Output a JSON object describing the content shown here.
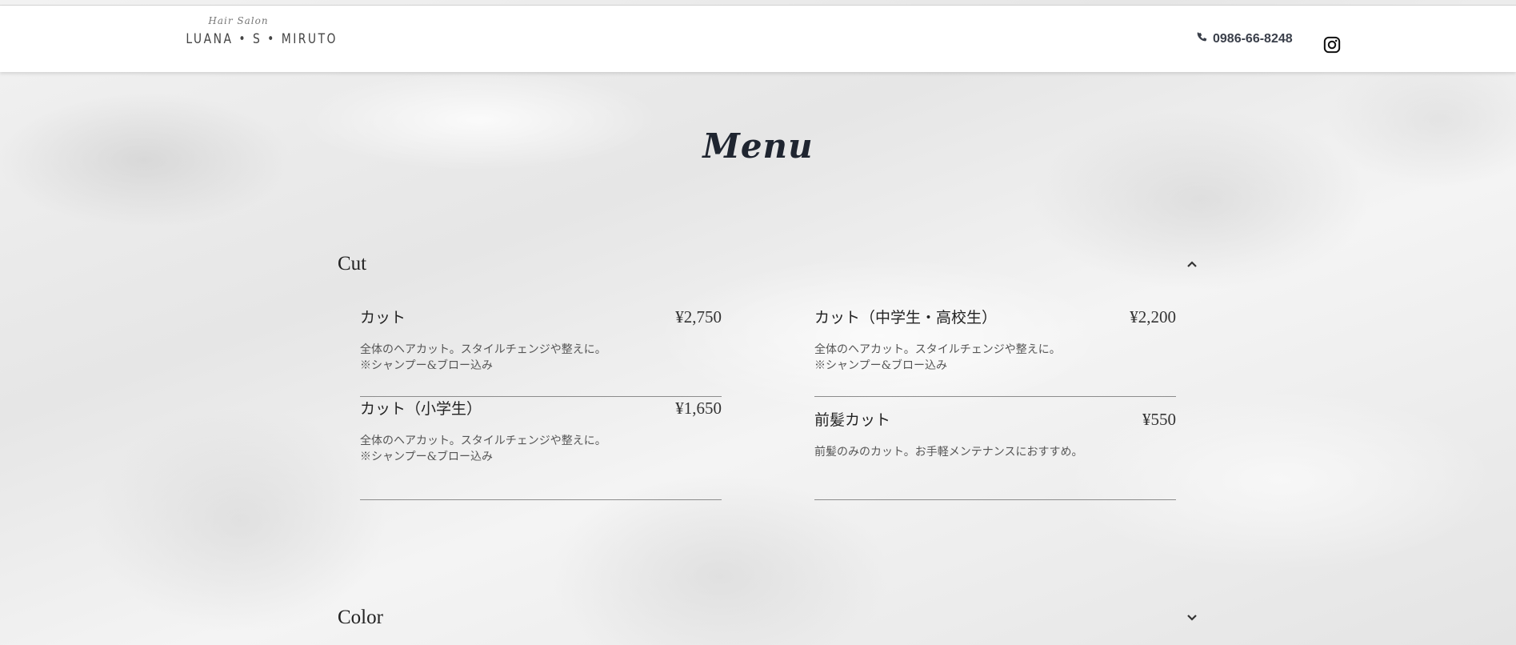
{
  "header": {
    "logo_small": "Hair Salon",
    "logo_main": "LUANA • S • MIRUTO",
    "phone": "0986-66-8248",
    "phone_icon": "phone-icon",
    "instagram_icon": "instagram-icon"
  },
  "page_title": "Menu",
  "sections": [
    {
      "title": "Cut",
      "expanded": true,
      "chevron": "chevron-up-icon",
      "items": [
        {
          "name": "カット",
          "price": "¥2,750",
          "desc": "全体のヘアカット。スタイルチェンジや整えに。\n※シャンプー&ブロー込み"
        },
        {
          "name": "カット（中学生・高校生）",
          "price": "¥2,200",
          "desc": "全体のヘアカット。スタイルチェンジや整えに。\n※シャンプー&ブロー込み"
        },
        {
          "name": "カット（小学生）",
          "price": "¥1,650",
          "desc": "全体のヘアカット。スタイルチェンジや整えに。\n※シャンプー&ブロー込み"
        },
        {
          "name": "前髪カット",
          "price": "¥550",
          "desc": "前髪のみのカット。お手軽メンテナンスにおすすめ。"
        }
      ]
    },
    {
      "title": "Color",
      "expanded": false,
      "chevron": "chevron-down-icon"
    }
  ],
  "colors": {
    "header_bg": "#ffffff",
    "text_dark": "#1f2530",
    "divider": "#8c8c8c"
  }
}
